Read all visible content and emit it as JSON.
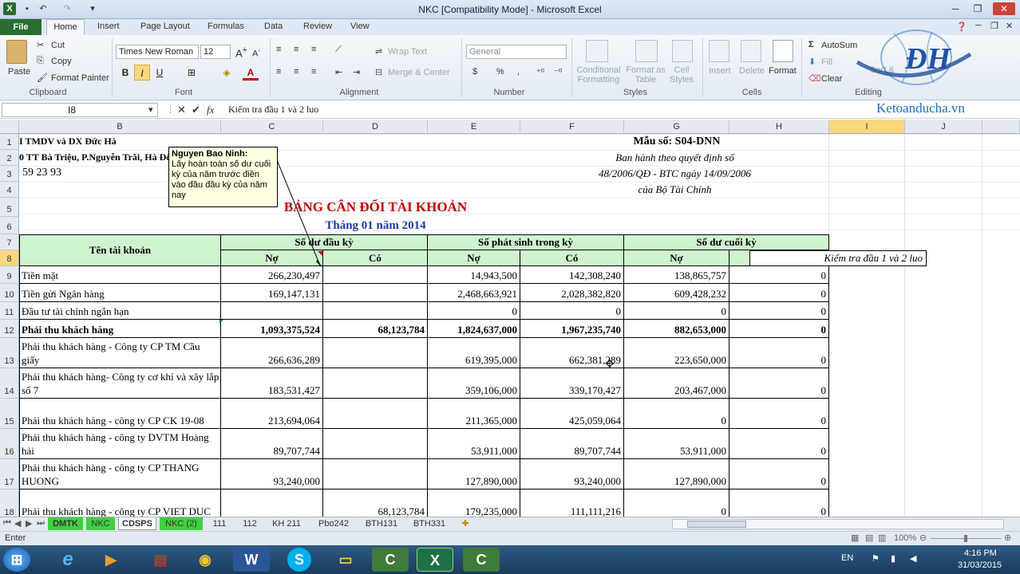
{
  "window": {
    "title": "NKC  [Compatibility Mode]  -  Microsoft Excel"
  },
  "tabs": [
    "File",
    "Home",
    "Insert",
    "Page Layout",
    "Formulas",
    "Data",
    "Review",
    "View"
  ],
  "ribbon": {
    "clipboard": {
      "paste": "Paste",
      "cut": "Cut",
      "copy": "Copy",
      "format_painter": "Format Painter",
      "label": "Clipboard"
    },
    "font": {
      "name": "Times New Roman",
      "size": "12",
      "label": "Font",
      "bold": "B",
      "italic": "I",
      "underline": "U"
    },
    "alignment": {
      "wrap_text": "Wrap Text",
      "merge": "Merge & Center",
      "label": "Alignment"
    },
    "number": {
      "format": "General",
      "label": "Number",
      "currency": "$",
      "percent": "%",
      "comma": ","
    },
    "styles": {
      "conditional": "Conditional Formatting",
      "format_table": "Format as Table",
      "cell_styles": "Cell Styles",
      "label": "Styles"
    },
    "cells": {
      "insert": "Insert",
      "delete": "Delete",
      "format": "Format",
      "label": "Cells"
    },
    "editing": {
      "autosum": "AutoSum",
      "fill": "Fill",
      "clear": "Clear",
      "sort": "Sort &",
      "label": "Editing"
    }
  },
  "logo": {
    "text": "ĐH",
    "site": "Ketoanducha.vn"
  },
  "formula_bar": {
    "name_box": "I8",
    "fx": "fx",
    "content": "Kiểm tra đầu 1 và 2 luo"
  },
  "columns": [
    "B",
    "C",
    "D",
    "E",
    "F",
    "G",
    "H",
    "I",
    "J"
  ],
  "rows": [
    "1",
    "2",
    "3",
    "4",
    "5",
    "6",
    "7",
    "8",
    "9",
    "10",
    "11",
    "12",
    "13",
    "14",
    "15",
    "16",
    "17",
    "18"
  ],
  "header": {
    "company": "I TMDV và DX Đức Hà",
    "address": "0 TT Bà Triệu, P.Nguyễn Trãi, Hà Đô",
    "phone": "59 23 93",
    "form_no": "Mẫu số: S04-DNN",
    "issued1": "Ban hành theo quyết định số",
    "issued2": "48/2006/QĐ - BTC ngày 14/09/2006",
    "issued3": "của Bộ Tài Chính",
    "title": "BẢNG CÂN ĐỐI TÀI KHOẢN",
    "subtitle": "Tháng 01 năm 2014"
  },
  "table_head": {
    "account": "Tên tài khoản",
    "opening": "Số dư đầu kỳ",
    "period": "Số phát sinh trong kỳ",
    "closing": "Số dư cuối kỳ",
    "debit": "Nợ",
    "credit": "Có",
    "check": "Kiểm tra đầu 1 và 2 luo"
  },
  "table_rows": [
    {
      "name": "Tiền mặt",
      "c": "266,230,497",
      "d": "",
      "e": "14,943,500",
      "f": "142,308,240",
      "g": "138,865,757",
      "h": "0"
    },
    {
      "name": "Tiền gửi Ngân hàng",
      "c": "169,147,131",
      "d": "",
      "e": "2,468,663,921",
      "f": "2,028,382,820",
      "g": "609,428,232",
      "h": "0"
    },
    {
      "name": "Đầu tư tài chính ngắn hạn",
      "c": "",
      "d": "",
      "e": "0",
      "f": "0",
      "g": "0",
      "h": "0"
    },
    {
      "name": "Phải thu khách hàng",
      "c": "1,093,375,524",
      "d": "68,123,784",
      "e": "1,824,637,000",
      "f": "1,967,235,740",
      "g": "882,653,000",
      "h": "0"
    },
    {
      "name": "Phải thu khách hàng - Công ty CP TM Cầu giấy",
      "c": "266,636,289",
      "d": "",
      "e": "619,395,000",
      "f": "662,381,289",
      "g": "223,650,000",
      "h": "0"
    },
    {
      "name": "Phải thu khách hàng- Công ty cơ khí và xây lắp số 7",
      "c": "183,531,427",
      "d": "",
      "e": "359,106,000",
      "f": "339,170,427",
      "g": "203,467,000",
      "h": "0"
    },
    {
      "name": "Phải thu khách hàng - công ty CP CK 19-08",
      "c": "213,694,064",
      "d": "",
      "e": "211,365,000",
      "f": "425,059,064",
      "g": "0",
      "h": "0"
    },
    {
      "name": "Phải thu khách hàng - công ty DVTM Hoàng hải",
      "c": "89,707,744",
      "d": "",
      "e": "53,911,000",
      "f": "89,707,744",
      "g": "53,911,000",
      "h": "0"
    },
    {
      "name": "Phải thu khách hàng - công ty CP THANG HUONG",
      "c": "93,240,000",
      "d": "",
      "e": "127,890,000",
      "f": "93,240,000",
      "g": "127,890,000",
      "h": "0"
    },
    {
      "name": "Phải thu khách hàng - công ty CP VIET DUC",
      "c": "",
      "d": "68,123,784",
      "e": "179,235,000",
      "f": "111,111,216",
      "g": "0",
      "h": "0"
    }
  ],
  "comment": {
    "author": "Nguyen Bao Ninh:",
    "text": "Lấy hoàn toàn số dư cuối kỳ của năm trước điền vào đầu đầu kỳ của năm nay"
  },
  "sheets": [
    "DMTK",
    "NKC",
    "CDSPS",
    "NKC (2)",
    "111",
    "112",
    "KH 211",
    "Pbo242",
    "BTH131",
    "BTH331"
  ],
  "status": {
    "mode": "Enter",
    "zoom": "100%"
  },
  "taskbar": {
    "lang": "EN",
    "time": "4:16 PM",
    "date": "31/03/2015"
  }
}
